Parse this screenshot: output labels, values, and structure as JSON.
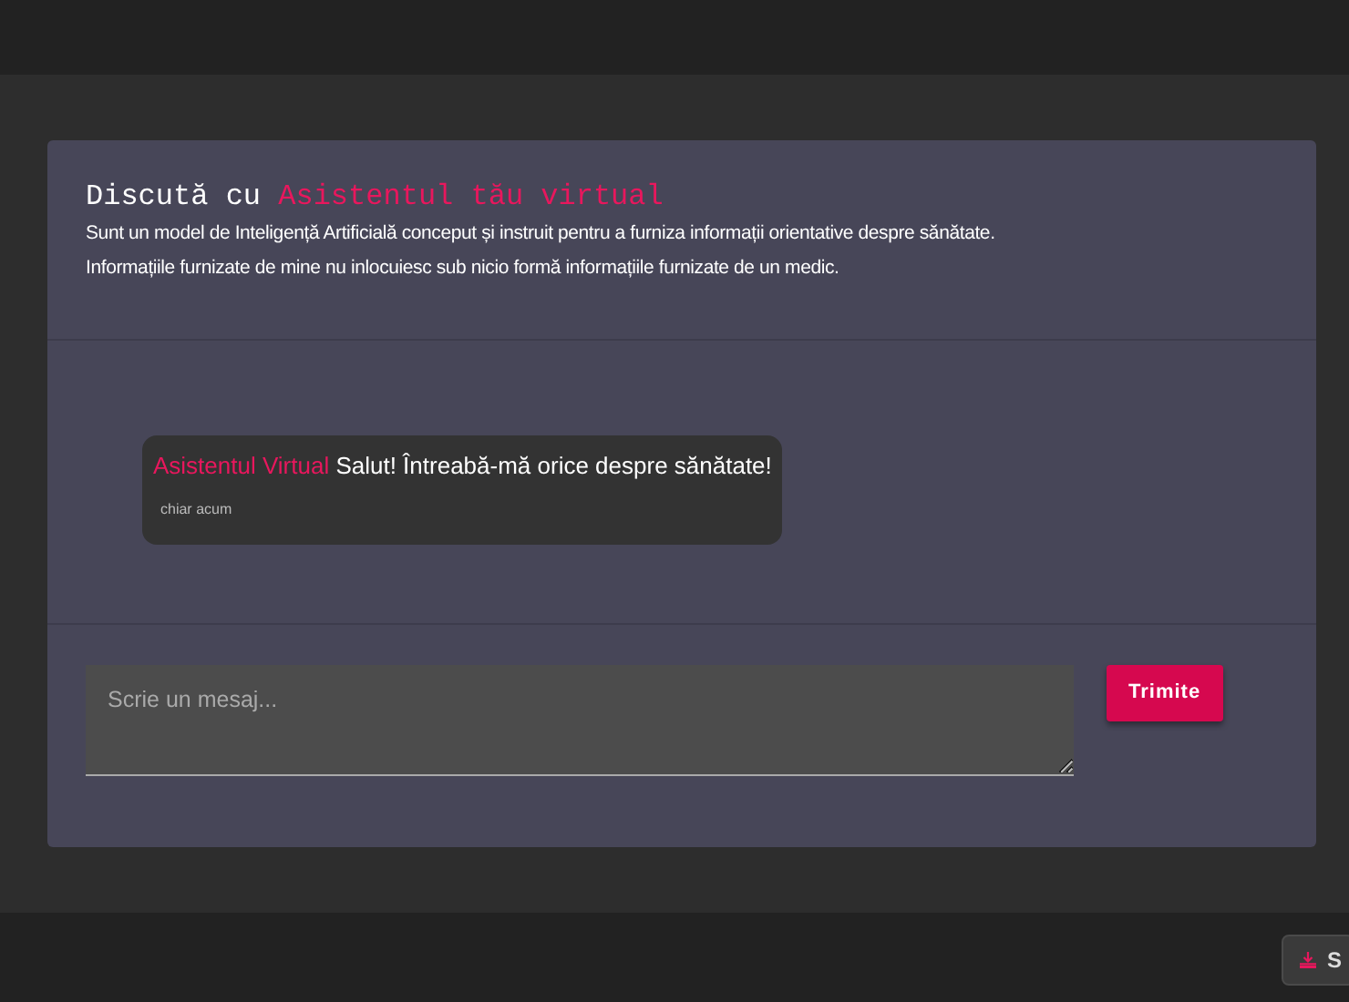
{
  "header": {
    "title": "Discută cu",
    "title_highlight": "Asistentul tău virtual",
    "lines": [
      "Sunt un model de Inteligență Artificială conceput și instruit pentru a furniza informații orientative despre sănătate.",
      "Informațiile furnizate de mine nu inlocuiesc sub nicio formă informațiile furnizate de un medic."
    ]
  },
  "messages": [
    {
      "sender": "Asistentul Virtual",
      "text": "Salut! Întreabă-mă orice despre sănătate!",
      "time": "chiar acum"
    }
  ],
  "composer": {
    "placeholder": "Scrie un mesaj...",
    "send_label": "Trimite"
  },
  "floating_button": {
    "label": "S"
  }
}
